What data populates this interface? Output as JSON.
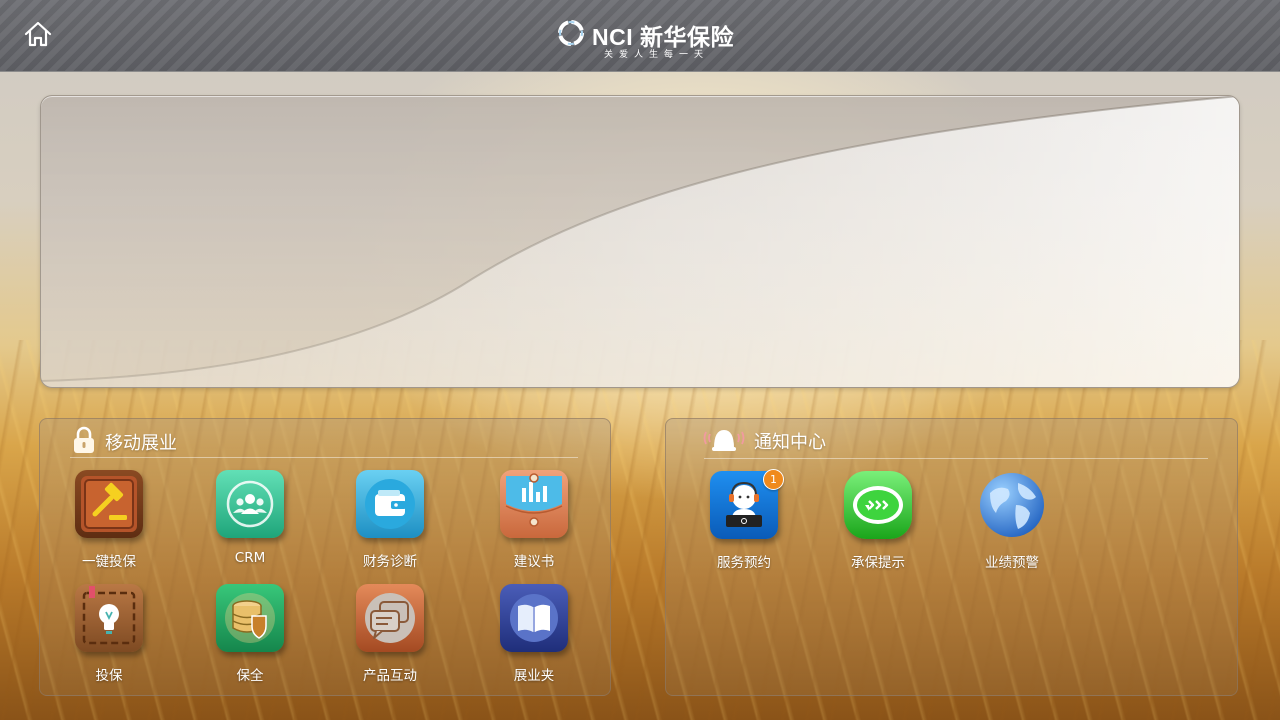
{
  "header": {
    "brand_name": "NCI 新华保险",
    "slogan": "关爱人生每一天"
  },
  "mobile_sales": {
    "title": "移动展业",
    "apps": [
      {
        "label": "一键投保",
        "icon": "gavel-icon"
      },
      {
        "label": "CRM",
        "icon": "crm-people-icon"
      },
      {
        "label": "财务诊断",
        "icon": "wallet-icon"
      },
      {
        "label": "建议书",
        "icon": "proposal-chart-icon"
      },
      {
        "label": "投保",
        "icon": "lightbulb-icon"
      },
      {
        "label": "保全",
        "icon": "database-shield-icon"
      },
      {
        "label": "产品互动",
        "icon": "chat-bubbles-icon"
      },
      {
        "label": "展业夹",
        "icon": "book-icon"
      }
    ]
  },
  "notification_center": {
    "title": "通知中心",
    "apps": [
      {
        "label": "服务预约",
        "icon": "customer-service-icon",
        "badge": "1"
      },
      {
        "label": "承保提示",
        "icon": "message-icon"
      },
      {
        "label": "业绩预警",
        "icon": "globe-icon"
      }
    ]
  },
  "colors": {
    "topbar": "#66676c",
    "badge": "#f08a1c",
    "text": "#ffffff"
  }
}
